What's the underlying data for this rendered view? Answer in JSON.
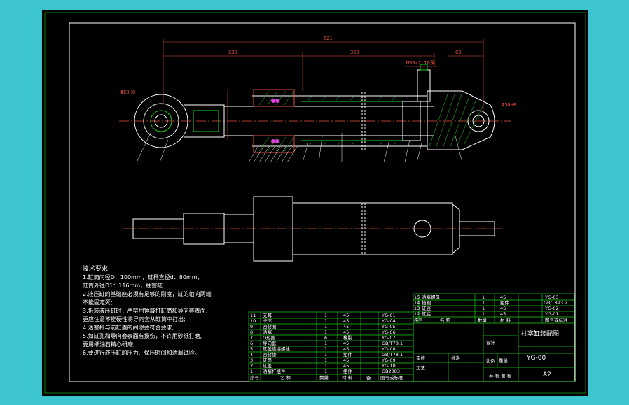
{
  "drawing": {
    "dimensions": {
      "overall": "621",
      "left_span": "230",
      "mid_span": "329",
      "right_span": "63",
      "port_size": "M33×2 18深",
      "rod_dia": "Φ28",
      "pin_left": "Φ50H8",
      "pin_right": "Φ50H8",
      "side_dim": "2×45"
    },
    "leader_numbers": [
      "1",
      "2",
      "3",
      "4",
      "5",
      "6",
      "7",
      "8",
      "9",
      "10",
      "11",
      "12",
      "13",
      "14",
      "15",
      "16"
    ]
  },
  "notes": {
    "heading": "技术要求",
    "lines": [
      "1.缸筒内径D：100mm，缸杆直径d：80mm，",
      "缸筒外径D1：116mm，柱塞缸.",
      "2.液压缸的基础座必须有足够的刚度，缸的轴向两端",
      "不能固定死;",
      "3.拆装液压缸时，严禁用锤敲打缸筒和导向套表面,",
      "更应注意不能硬性将导向套从缸筒中打出;",
      "4.活塞杆与前缸盖的间隙要符合要求;",
      "5.如缸孔和导向套表面有损伤，不许用砂纸打磨,",
      "要用细油石精心研磨;",
      "6.要进行液压缸的压力、保压时间和泄漏试验。"
    ]
  },
  "bom_left": {
    "rows": [
      {
        "no": "1",
        "name": "活塞杆组件",
        "qty": "1",
        "mat": "组件",
        "std": "GB2883"
      },
      {
        "no": "2",
        "name": "缸盖",
        "qty": "1",
        "mat": "45",
        "std": "YG-10"
      },
      {
        "no": "3",
        "name": "缸筒",
        "qty": "1",
        "mat": "45",
        "std": "YG-09"
      },
      {
        "no": "4",
        "name": "密封垫",
        "qty": "1",
        "mat": "组件",
        "std": "GB/T78.1"
      },
      {
        "no": "5",
        "name": "缸盖连接螺栓",
        "qty": "1",
        "mat": "45",
        "std": "YG-08"
      },
      {
        "no": "6",
        "name": "导向套",
        "qty": "1",
        "mat": "45",
        "std": "GB/T78.1"
      },
      {
        "no": "7",
        "name": "O形圈",
        "qty": "6",
        "mat": "橡胶",
        "std": "YG-07"
      },
      {
        "no": "8",
        "name": "活塞",
        "qty": "1",
        "mat": "45",
        "std": "YG-06"
      },
      {
        "no": "9",
        "name": "密封圈",
        "qty": "1",
        "mat": "45",
        "std": "YG-05"
      },
      {
        "no": "10",
        "name": "卡环",
        "qty": "1",
        "mat": "45",
        "std": "YG-04"
      },
      {
        "no": "11",
        "name": "支耳",
        "qty": "1",
        "mat": "45",
        "std": "YG-01"
      }
    ],
    "header": {
      "no": "序号",
      "name": "名 称",
      "qty": "数量",
      "mat": "材 料",
      "note": "备",
      "std": "图号或标准"
    }
  },
  "bom_right": {
    "rows": [
      {
        "no": "15",
        "name": "活塞螺母",
        "qty": "1",
        "mat": "45",
        "std": "YG-03"
      },
      {
        "no": "14",
        "name": "挡圈",
        "qty": "1",
        "mat": "组件",
        "std": "GB/T893.2"
      },
      {
        "no": "13",
        "name": "缸底",
        "qty": "1",
        "mat": "45",
        "std": "YG-02"
      },
      {
        "no": "12",
        "name": "缸底",
        "qty": "1",
        "mat": "45",
        "std": "YG-01"
      }
    ],
    "header": {
      "no": "序号",
      "name": "名 称",
      "qty": "数量",
      "mat": "材 料",
      "std": "图号或标准"
    }
  },
  "title_block": {
    "title": "柱塞缸装配图",
    "drawing_no": "YG-00",
    "size": "A2",
    "labels": [
      "设计",
      "审核",
      "工艺",
      "批准",
      "比例",
      "数量",
      "材料"
    ],
    "scale_label": "比例",
    "weight_label": "重量",
    "school": "共 张 第 张"
  },
  "colors": {
    "background": "#3cc4cf",
    "sheet": "#000000",
    "border": "#ffffff",
    "green": "#19d119",
    "red": "#e8503a",
    "hatch": "#1fa21f",
    "magenta": "#e040e0"
  }
}
